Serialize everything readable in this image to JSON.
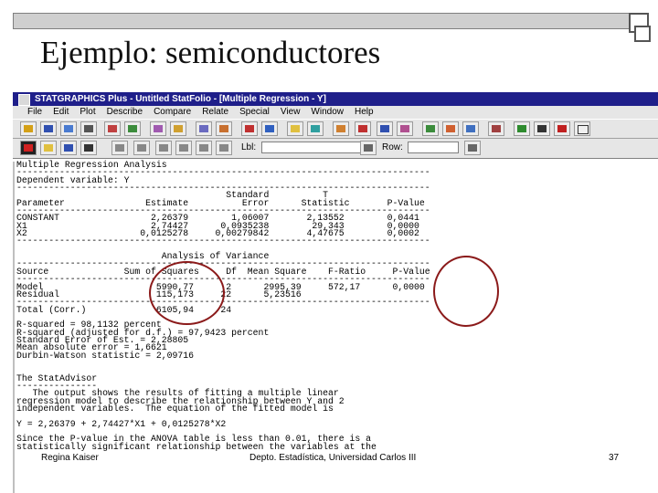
{
  "slide": {
    "title": "Ejemplo: semiconductores",
    "footer_author": "Regina Kaiser",
    "footer_dept": "Depto. Estadística, Universidad Carlos III",
    "page_number": "37"
  },
  "app": {
    "window_title": "STATGRAPHICS Plus - Untitled StatFolio - [Multiple Regression - Y]",
    "menu": [
      "File",
      "Edit",
      "Plot",
      "Describe",
      "Compare",
      "Relate",
      "Special",
      "View",
      "Window",
      "Help"
    ],
    "toolbar": {
      "lbl_label": "Lbl:",
      "row_label": "Row:"
    }
  },
  "output": {
    "lines": [
      "Multiple Regression Analysis",
      "-----------------------------------------------------------------------------",
      "Dependent variable: Y",
      "-----------------------------------------------------------------------------",
      "                                       Standard          T",
      "Parameter               Estimate          Error      Statistic       P-Value",
      "-----------------------------------------------------------------------------",
      "CONSTANT                 2,26379        1,06007       2,13552        0,0441",
      "X1                       2,74427      0,0935238        29,343        0,0000",
      "X2                     0,0125278     0,00279842       4,47675        0,0002",
      "-----------------------------------------------------------------------------",
      "",
      "                           Analysis of Variance",
      "-----------------------------------------------------------------------------",
      "Source              Sum of Squares     Df  Mean Square    F-Ratio     P-Value",
      "-----------------------------------------------------------------------------",
      "Model                     5990,77      2      2995,39     572,17      0,0000",
      "Residual                  115,173     22      5,23516",
      "-----------------------------------------------------------------------------",
      "Total (Corr.)             6105,94     24",
      "",
      "R-squared = 98,1132 percent",
      "R-squared (adjusted for d.f.) = 97,9423 percent",
      "Standard Error of Est. = 2,28805",
      "Mean absolute error = 1,6621",
      "Durbin-Watson statistic = 2,09716",
      "",
      "",
      "The StatAdvisor",
      "---------------",
      "   The output shows the results of fitting a multiple linear",
      "regression model to describe the relationship between Y and 2",
      "independent variables.  The equation of the fitted model is",
      "",
      "Y = 2,26379 + 2,74427*X1 + 0,0125278*X2",
      "",
      "Since the P-value in the ANOVA table is less than 0.01, there is a",
      "statistically significant relationship between the variables at the"
    ]
  },
  "colors": {
    "titlebar": "#1f1f8a",
    "highlight_circle": "#8b1a1a"
  }
}
